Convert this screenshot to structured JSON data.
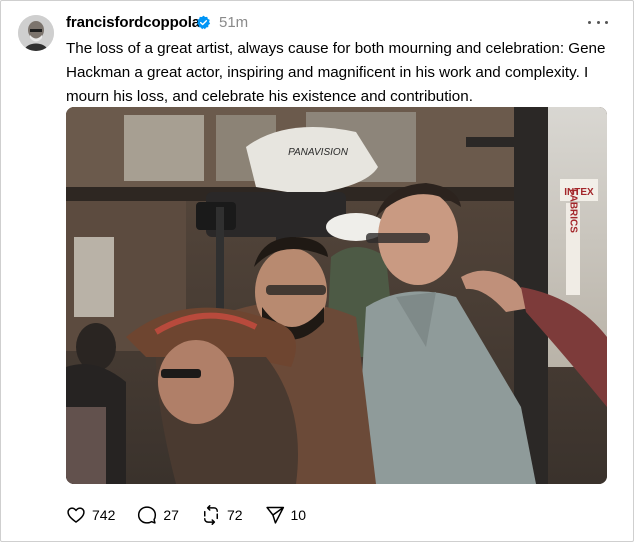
{
  "post": {
    "username": "francisfordcoppola",
    "time": "51m",
    "text": "The loss of a great artist, always cause for both mourning and celebration: Gene Hackman a great actor, inspiring and magnificent in his work and complexity. I mourn his loss, and celebrate his existence and contribution.",
    "image": {
      "camera_text": "PANAVISION",
      "sign_text": "INTEX",
      "sign_text_2": "FABRICS"
    }
  },
  "actions": {
    "likes": "742",
    "replies": "27",
    "reposts": "72",
    "shares": "10"
  },
  "colors": {
    "verified": "#0095f6",
    "muted_text": "#8a8a8a"
  }
}
